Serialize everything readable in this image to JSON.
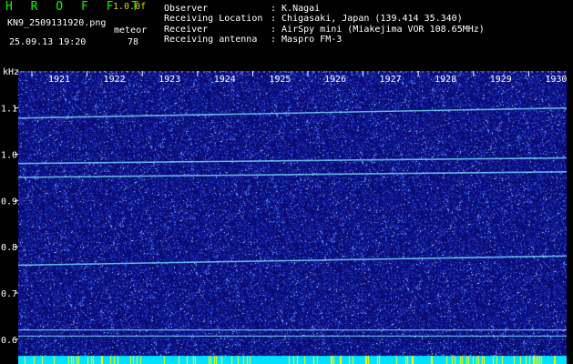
{
  "header": {
    "app_title": "H R O F F T",
    "version": "1.0.0f",
    "filename": "KN9_2509131920.png",
    "mode": "meteor",
    "datetime": "25.09.13 19:20",
    "count": "78"
  },
  "info": {
    "observer_key": "Observer",
    "observer_val": ": K.Nagai",
    "location_key": "Receiving Location",
    "location_val": ": Chigasaki, Japan (139.414 35.340)",
    "receiver_key": "Receiver",
    "receiver_val": ": AirSpy mini (Miakejima VOR 108.65MHz)",
    "antenna_key": "Receiving antenna",
    "antenna_val": ": Maspro FM-3"
  },
  "chart_data": {
    "type": "heatmap",
    "ylabel": "kHz",
    "x_ticks": [
      "1921",
      "1922",
      "1923",
      "1924",
      "1925",
      "1926",
      "1927",
      "1928",
      "1929",
      "1930"
    ],
    "y_ticks": [
      "1.1",
      "1.0",
      "0.9",
      "0.8",
      "0.7",
      "0.6"
    ],
    "ylim": [
      0.57,
      1.18
    ],
    "colors": {
      "background": "#0a0a6e",
      "noise": "#3a5cff",
      "signal": "#7fe6ff",
      "bottom_strip": "#00e0ff",
      "bottom_yellow": "#ffff00"
    },
    "signal_lines": [
      {
        "start_khz": 1.078,
        "end_khz": 1.1
      },
      {
        "start_khz": 0.98,
        "end_khz": 0.992
      },
      {
        "start_khz": 0.95,
        "end_khz": 0.962
      },
      {
        "start_khz": 0.76,
        "end_khz": 0.78
      },
      {
        "start_khz": 0.62,
        "end_khz": 0.62
      },
      {
        "start_khz": 0.607,
        "end_khz": 0.607
      }
    ]
  }
}
